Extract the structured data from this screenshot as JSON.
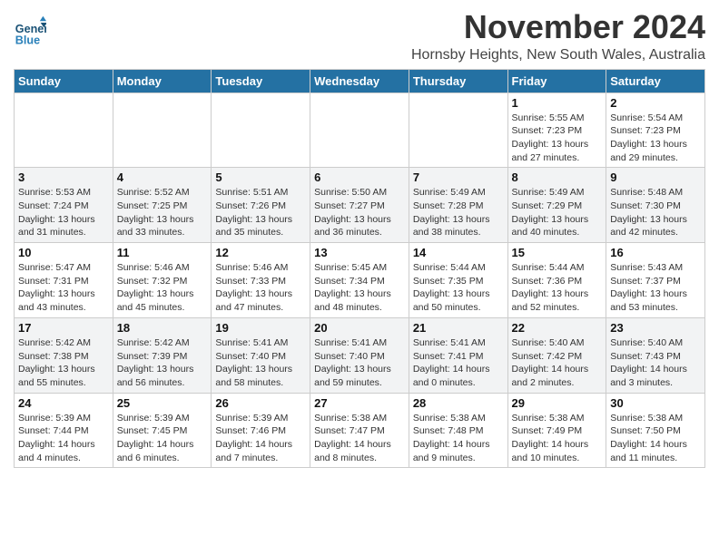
{
  "logo": {
    "text_general": "General",
    "text_blue": "Blue"
  },
  "title": "November 2024",
  "location": "Hornsby Heights, New South Wales, Australia",
  "weekdays": [
    "Sunday",
    "Monday",
    "Tuesday",
    "Wednesday",
    "Thursday",
    "Friday",
    "Saturday"
  ],
  "weeks": [
    [
      {
        "day": "",
        "sunrise": "",
        "sunset": "",
        "daylight": ""
      },
      {
        "day": "",
        "sunrise": "",
        "sunset": "",
        "daylight": ""
      },
      {
        "day": "",
        "sunrise": "",
        "sunset": "",
        "daylight": ""
      },
      {
        "day": "",
        "sunrise": "",
        "sunset": "",
        "daylight": ""
      },
      {
        "day": "",
        "sunrise": "",
        "sunset": "",
        "daylight": ""
      },
      {
        "day": "1",
        "sunrise": "Sunrise: 5:55 AM",
        "sunset": "Sunset: 7:23 PM",
        "daylight": "Daylight: 13 hours and 27 minutes."
      },
      {
        "day": "2",
        "sunrise": "Sunrise: 5:54 AM",
        "sunset": "Sunset: 7:23 PM",
        "daylight": "Daylight: 13 hours and 29 minutes."
      }
    ],
    [
      {
        "day": "3",
        "sunrise": "Sunrise: 5:53 AM",
        "sunset": "Sunset: 7:24 PM",
        "daylight": "Daylight: 13 hours and 31 minutes."
      },
      {
        "day": "4",
        "sunrise": "Sunrise: 5:52 AM",
        "sunset": "Sunset: 7:25 PM",
        "daylight": "Daylight: 13 hours and 33 minutes."
      },
      {
        "day": "5",
        "sunrise": "Sunrise: 5:51 AM",
        "sunset": "Sunset: 7:26 PM",
        "daylight": "Daylight: 13 hours and 35 minutes."
      },
      {
        "day": "6",
        "sunrise": "Sunrise: 5:50 AM",
        "sunset": "Sunset: 7:27 PM",
        "daylight": "Daylight: 13 hours and 36 minutes."
      },
      {
        "day": "7",
        "sunrise": "Sunrise: 5:49 AM",
        "sunset": "Sunset: 7:28 PM",
        "daylight": "Daylight: 13 hours and 38 minutes."
      },
      {
        "day": "8",
        "sunrise": "Sunrise: 5:49 AM",
        "sunset": "Sunset: 7:29 PM",
        "daylight": "Daylight: 13 hours and 40 minutes."
      },
      {
        "day": "9",
        "sunrise": "Sunrise: 5:48 AM",
        "sunset": "Sunset: 7:30 PM",
        "daylight": "Daylight: 13 hours and 42 minutes."
      }
    ],
    [
      {
        "day": "10",
        "sunrise": "Sunrise: 5:47 AM",
        "sunset": "Sunset: 7:31 PM",
        "daylight": "Daylight: 13 hours and 43 minutes."
      },
      {
        "day": "11",
        "sunrise": "Sunrise: 5:46 AM",
        "sunset": "Sunset: 7:32 PM",
        "daylight": "Daylight: 13 hours and 45 minutes."
      },
      {
        "day": "12",
        "sunrise": "Sunrise: 5:46 AM",
        "sunset": "Sunset: 7:33 PM",
        "daylight": "Daylight: 13 hours and 47 minutes."
      },
      {
        "day": "13",
        "sunrise": "Sunrise: 5:45 AM",
        "sunset": "Sunset: 7:34 PM",
        "daylight": "Daylight: 13 hours and 48 minutes."
      },
      {
        "day": "14",
        "sunrise": "Sunrise: 5:44 AM",
        "sunset": "Sunset: 7:35 PM",
        "daylight": "Daylight: 13 hours and 50 minutes."
      },
      {
        "day": "15",
        "sunrise": "Sunrise: 5:44 AM",
        "sunset": "Sunset: 7:36 PM",
        "daylight": "Daylight: 13 hours and 52 minutes."
      },
      {
        "day": "16",
        "sunrise": "Sunrise: 5:43 AM",
        "sunset": "Sunset: 7:37 PM",
        "daylight": "Daylight: 13 hours and 53 minutes."
      }
    ],
    [
      {
        "day": "17",
        "sunrise": "Sunrise: 5:42 AM",
        "sunset": "Sunset: 7:38 PM",
        "daylight": "Daylight: 13 hours and 55 minutes."
      },
      {
        "day": "18",
        "sunrise": "Sunrise: 5:42 AM",
        "sunset": "Sunset: 7:39 PM",
        "daylight": "Daylight: 13 hours and 56 minutes."
      },
      {
        "day": "19",
        "sunrise": "Sunrise: 5:41 AM",
        "sunset": "Sunset: 7:40 PM",
        "daylight": "Daylight: 13 hours and 58 minutes."
      },
      {
        "day": "20",
        "sunrise": "Sunrise: 5:41 AM",
        "sunset": "Sunset: 7:40 PM",
        "daylight": "Daylight: 13 hours and 59 minutes."
      },
      {
        "day": "21",
        "sunrise": "Sunrise: 5:41 AM",
        "sunset": "Sunset: 7:41 PM",
        "daylight": "Daylight: 14 hours and 0 minutes."
      },
      {
        "day": "22",
        "sunrise": "Sunrise: 5:40 AM",
        "sunset": "Sunset: 7:42 PM",
        "daylight": "Daylight: 14 hours and 2 minutes."
      },
      {
        "day": "23",
        "sunrise": "Sunrise: 5:40 AM",
        "sunset": "Sunset: 7:43 PM",
        "daylight": "Daylight: 14 hours and 3 minutes."
      }
    ],
    [
      {
        "day": "24",
        "sunrise": "Sunrise: 5:39 AM",
        "sunset": "Sunset: 7:44 PM",
        "daylight": "Daylight: 14 hours and 4 minutes."
      },
      {
        "day": "25",
        "sunrise": "Sunrise: 5:39 AM",
        "sunset": "Sunset: 7:45 PM",
        "daylight": "Daylight: 14 hours and 6 minutes."
      },
      {
        "day": "26",
        "sunrise": "Sunrise: 5:39 AM",
        "sunset": "Sunset: 7:46 PM",
        "daylight": "Daylight: 14 hours and 7 minutes."
      },
      {
        "day": "27",
        "sunrise": "Sunrise: 5:38 AM",
        "sunset": "Sunset: 7:47 PM",
        "daylight": "Daylight: 14 hours and 8 minutes."
      },
      {
        "day": "28",
        "sunrise": "Sunrise: 5:38 AM",
        "sunset": "Sunset: 7:48 PM",
        "daylight": "Daylight: 14 hours and 9 minutes."
      },
      {
        "day": "29",
        "sunrise": "Sunrise: 5:38 AM",
        "sunset": "Sunset: 7:49 PM",
        "daylight": "Daylight: 14 hours and 10 minutes."
      },
      {
        "day": "30",
        "sunrise": "Sunrise: 5:38 AM",
        "sunset": "Sunset: 7:50 PM",
        "daylight": "Daylight: 14 hours and 11 minutes."
      }
    ]
  ]
}
